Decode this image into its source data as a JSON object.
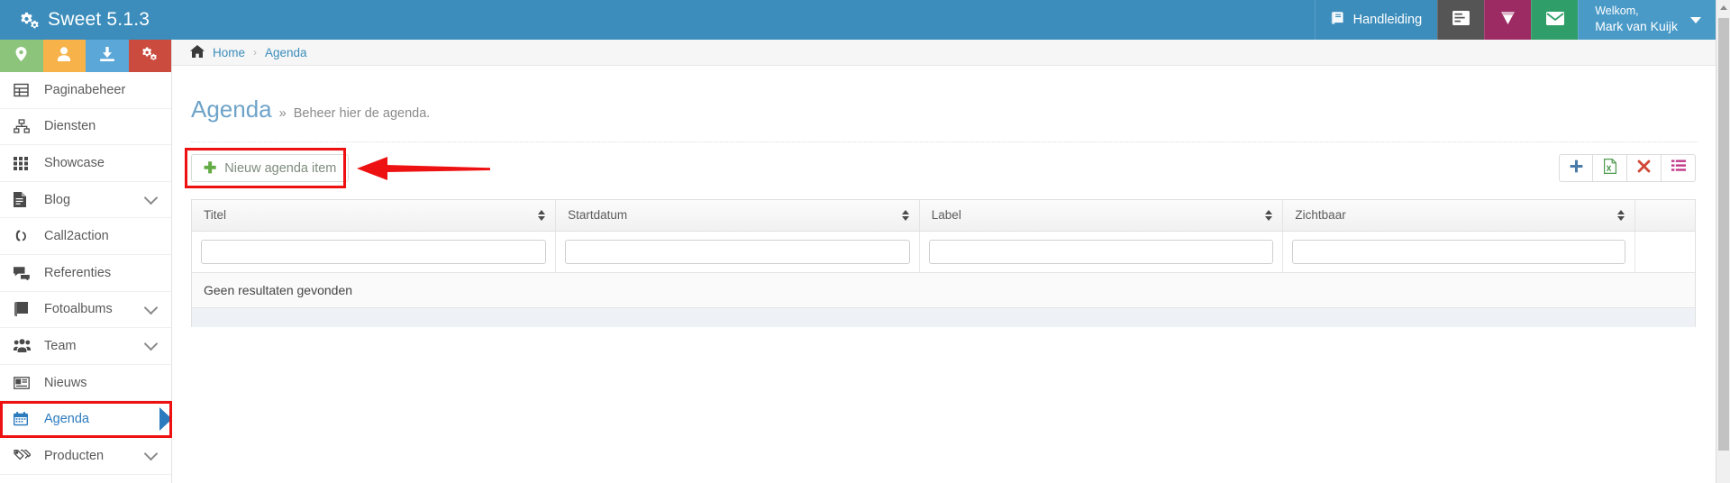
{
  "topbar": {
    "brand": "Sweet 5.1.3",
    "brand_icon": "cogs-icon",
    "buttons": [
      {
        "label": "Handleiding",
        "icon": "book-icon",
        "color": "#3c8dbc"
      },
      {
        "label": "",
        "icon": "form-list-icon",
        "color": "#555555"
      },
      {
        "label": "",
        "icon": "diamond-icon",
        "color": "#9c2b63"
      },
      {
        "label": "",
        "icon": "envelope-icon",
        "color": "#2f9e68"
      }
    ],
    "user": {
      "greeting": "Welkom,",
      "name": "Mark van Kuijk"
    }
  },
  "quick_actions": [
    {
      "name": "location-pin-icon",
      "color": "#8cc47c"
    },
    {
      "name": "user-icon",
      "color": "#f7b24a"
    },
    {
      "name": "download-icon",
      "color": "#5ba8d8"
    },
    {
      "name": "cogs-icon",
      "color": "#cb4b3f"
    }
  ],
  "sidebar": {
    "items": [
      {
        "label": "Paginabeheer",
        "icon": "table-icon",
        "expandable": false,
        "active": false
      },
      {
        "label": "Diensten",
        "icon": "sitemap-icon",
        "expandable": false,
        "active": false
      },
      {
        "label": "Showcase",
        "icon": "grid-icon",
        "expandable": false,
        "active": false
      },
      {
        "label": "Blog",
        "icon": "document-icon",
        "expandable": true,
        "active": false
      },
      {
        "label": "Call2action",
        "icon": "phone-icon",
        "expandable": false,
        "active": false
      },
      {
        "label": "Referenties",
        "icon": "comments-icon",
        "expandable": false,
        "active": false
      },
      {
        "label": "Fotoalbums",
        "icon": "book-icon",
        "expandable": true,
        "active": false
      },
      {
        "label": "Team",
        "icon": "users-icon",
        "expandable": true,
        "active": false
      },
      {
        "label": "Nieuws",
        "icon": "newspaper-icon",
        "expandable": false,
        "active": false
      },
      {
        "label": "Agenda",
        "icon": "calendar-icon",
        "expandable": false,
        "active": true
      },
      {
        "label": "Producten",
        "icon": "tags-icon",
        "expandable": true,
        "active": false
      }
    ]
  },
  "breadcrumb": {
    "home": "Home",
    "separator": "›",
    "current": "Agenda",
    "home_icon": "home-icon"
  },
  "page": {
    "title": "Agenda",
    "sub_marker": "»",
    "subtitle": "Beheer hier de agenda."
  },
  "toolbar": {
    "new_item_label": "Nieuw agenda item",
    "new_item_icon": "plus-icon",
    "actions": [
      {
        "name": "add-icon",
        "color": "#4b7ba8"
      },
      {
        "name": "excel-export-icon",
        "color": "#4f9a4f"
      },
      {
        "name": "delete-icon",
        "color": "#d14836"
      },
      {
        "name": "columns-icon",
        "color": "#c2398a"
      }
    ]
  },
  "table": {
    "columns": [
      {
        "label": "Titel",
        "sortable": true,
        "filter_value": "",
        "filter_placeholder": ""
      },
      {
        "label": "Startdatum",
        "sortable": true,
        "filter_value": "",
        "filter_placeholder": ""
      },
      {
        "label": "Label",
        "sortable": true,
        "filter_value": "",
        "filter_placeholder": ""
      },
      {
        "label": "Zichtbaar",
        "sortable": true,
        "filter_value": "",
        "filter_placeholder": ""
      }
    ],
    "empty_message": "Geen resultaten gevonden",
    "rows": []
  },
  "annotations": {
    "highlight_color": "#ee1111",
    "boxes": [
      "nieuw-agenda-item-button",
      "sidebar-item-agenda"
    ],
    "arrow": {
      "direction": "left",
      "target": "nieuw-agenda-item-button"
    }
  }
}
